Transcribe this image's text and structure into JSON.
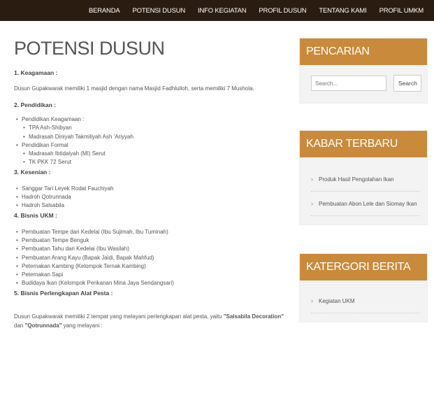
{
  "nav": [
    "BERANDA",
    "POTENSI DUSUN",
    "INFO KEGIATAN",
    "PROFIL DUSUN",
    "TENTANG KAMI",
    "PROFIL UMKM"
  ],
  "page_title": "POTENSI DUSUN",
  "sections": {
    "s1_title": "1. Keagamaan :",
    "s1_text": "Dusun Gupakwarak memiliki 1 masjid dengan nama Masjid Fadhlulloh, serta memiliki 7 Mushola.",
    "s2_title": "2. Pendidikan :",
    "s2_items": [
      "Pendidikan Keagamaan :",
      "TPA Ash-Shibyan",
      "Madrasah Diniyah Takmiliyah Ash 'Ariyyah",
      "Pendidikan Formal",
      "Madrasah Ibtidaiyah (MI) Serut",
      "TK PKK 72 Serut"
    ],
    "s3_title": "3. Kesenian :",
    "s3_items": [
      "Sanggar Tari Leyek Rodat Fauchiyah",
      "Hadroh Qotrunnada",
      "Hadroh Salsabila"
    ],
    "s4_title": "4. Bisnis UKM :",
    "s4_items": [
      "Pembuatan Tempe dari Kedelai (Ibu Sujimah, Ibu Tuminah)",
      "Pembuatan Tempe Benguk",
      "Pembuatan Tahu dari Kedelai (Ibu Wasilah)",
      "Pembuatan Arang Kayu (Bapak Jaidi, Bapak Mahfud)",
      "Peternakan Kambing (Kelompok Ternak Kambing)",
      "Peternakan Sapi",
      "Budidaya Ikan (Kelompok Perikanan Mina Jaya Sendangsari)"
    ],
    "s5_title": "5. Bisnis Perlengkapan Alat Pesta :",
    "s5_text_a": "Dusun Gupakwarak memiliki 2 tempat yang melayani perlengkapan alat pesta, yaitu ",
    "s5_bold1": "\"Salsabila Decoration\"",
    "s5_text_b": " dan ",
    "s5_bold2": "\"Qotrunnada\"",
    "s5_text_c": " yang melayani :"
  },
  "sidebar": {
    "search_title": "PENCARIAN",
    "search_placeholder": "Search...",
    "search_button": "Search",
    "news_title": "KABAR TERBARU",
    "news_items": [
      "Produk Hasil Pengolahan Ikan",
      "Pembuatan Abon Lele dan Siomay Ikan"
    ],
    "category_title": "KATERGORI BERITA",
    "category_items": [
      "Kegiatan UKM"
    ]
  },
  "colors": {
    "topbar": "#2b1c12",
    "accent": "#c98a3c"
  }
}
